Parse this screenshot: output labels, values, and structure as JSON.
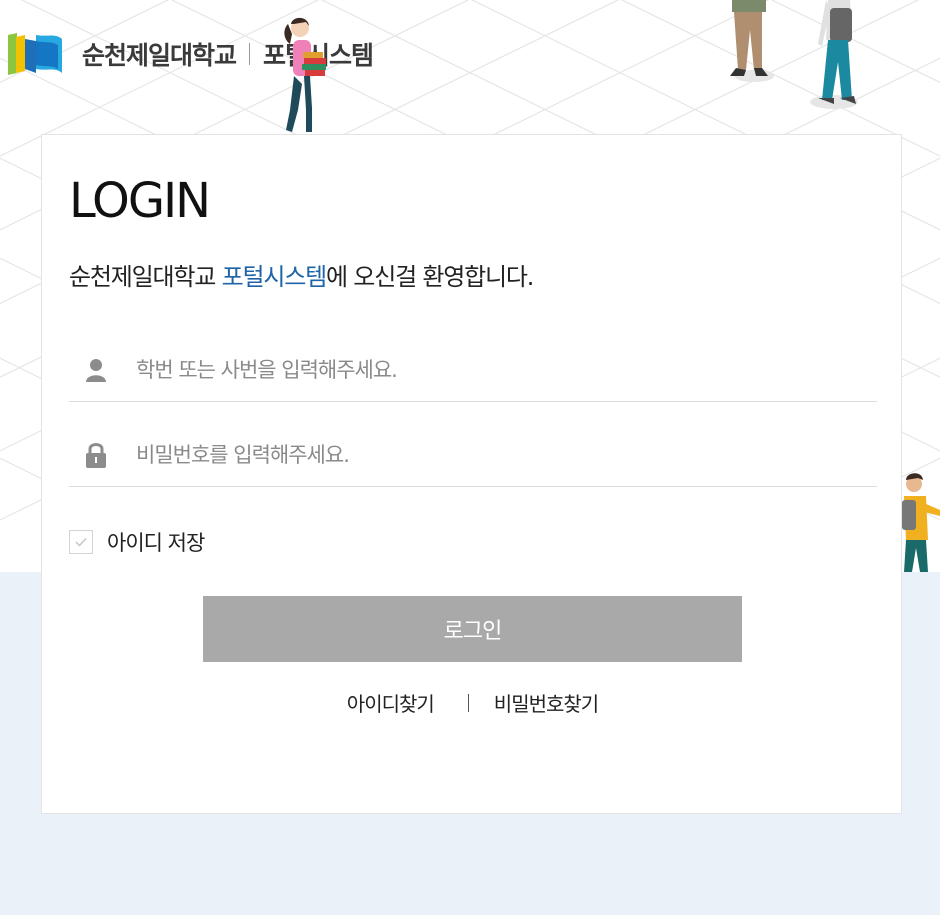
{
  "header": {
    "school_name": "순천제일대학교",
    "portal_name": "포털시스템"
  },
  "login": {
    "title": "LOGIN",
    "welcome_prefix": "순천제일대학교 ",
    "welcome_highlight": "포털시스템",
    "welcome_suffix": "에 오신걸 환영합니다.",
    "id_placeholder": "학번 또는 사번을 입력해주세요.",
    "id_value": "",
    "password_placeholder": "비밀번호를 입력해주세요.",
    "password_value": "",
    "save_id_label": "아이디 저장",
    "save_id_checked": false,
    "login_button": "로그인",
    "find_id_link": "아이디찾기",
    "find_password_link": "비밀번호찾기"
  },
  "icons": {
    "user": "user-icon",
    "password": "lock-icon",
    "checkbox": "check-icon"
  },
  "colors": {
    "highlight": "#1f63a8",
    "button": "#a9a9a9",
    "bottom_background": "#eaf1f8"
  }
}
